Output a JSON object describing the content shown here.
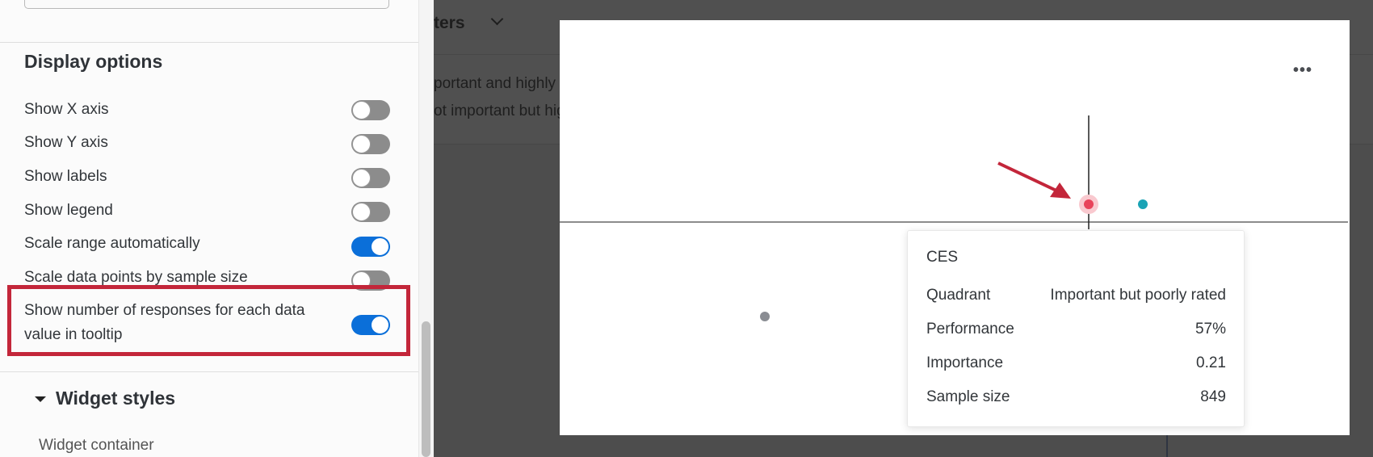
{
  "panel": {
    "section_title": "Display options",
    "options": [
      {
        "label": "Show X axis",
        "on": false
      },
      {
        "label": "Show Y axis",
        "on": false
      },
      {
        "label": "Show labels",
        "on": false
      },
      {
        "label": "Show legend",
        "on": false
      },
      {
        "label": "Scale range automatically",
        "on": true
      },
      {
        "label": "Scale data points by sample size",
        "on": false
      }
    ],
    "highlighted_option": {
      "label": "Show number of responses for each data value in tooltip",
      "on": true
    },
    "widget_styles": "Widget styles",
    "widget_container": "Widget container"
  },
  "background": {
    "header_fragment": "ters",
    "line1": "portant and highly",
    "line2": "ot important but hig"
  },
  "widget": {
    "more_label": "•••"
  },
  "tooltip": {
    "title": "CES",
    "rows": [
      {
        "label": "Quadrant",
        "value": "Important but poorly rated"
      },
      {
        "label": "Performance",
        "value": "57%"
      },
      {
        "label": "Importance",
        "value": "0.21"
      },
      {
        "label": "Sample size",
        "value": "849"
      }
    ]
  },
  "colors": {
    "accent": "#0b6fd9",
    "highlight": "#c3263a",
    "point_selected": "#e8435a",
    "point_teal": "#1aa3b5",
    "point_gray": "#8a8d93"
  }
}
